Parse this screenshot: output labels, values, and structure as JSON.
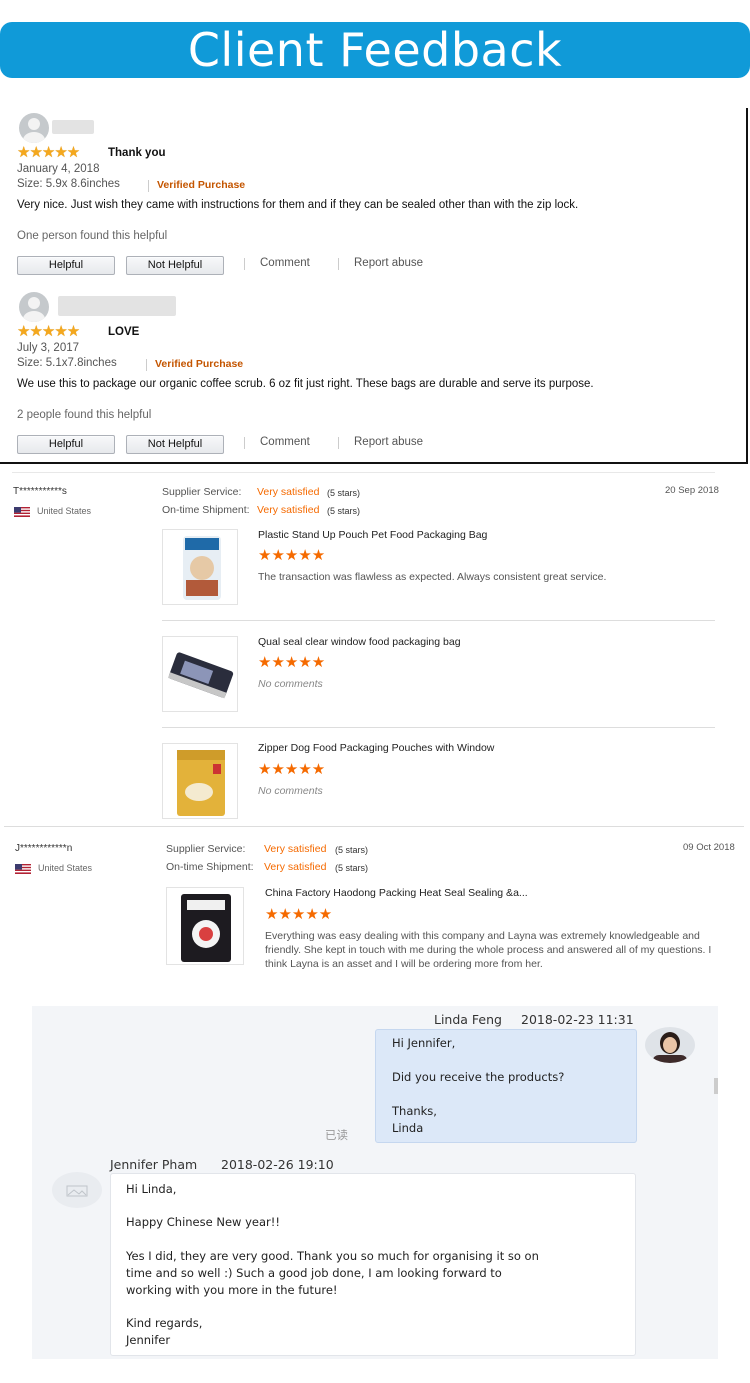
{
  "banner": {
    "title": "Client Feedback",
    "color": "#109ad8"
  },
  "amazon_reviews": [
    {
      "title": "Thank you",
      "date": "January 4, 2018",
      "size": "Size: 5.9x 8.6inches",
      "verified": "Verified Purchase",
      "text": "Very nice. Just wish they came with instructions for them and if they can be sealed other than with the zip lock.",
      "helpful_count": "One person found this helpful",
      "helpful_label": "Helpful",
      "not_helpful_label": "Not Helpful",
      "comment_label": "Comment",
      "report_label": "Report abuse",
      "stars": 5
    },
    {
      "title": "LOVE",
      "date": "July 3, 2017",
      "size": "Size: 5.1x7.8inches",
      "verified": "Verified Purchase",
      "text": "We use this to package our organic coffee scrub. 6 oz fit just right. These bags are durable and serve its purpose.",
      "helpful_count": "2 people found this helpful",
      "helpful_label": "Helpful",
      "not_helpful_label": "Not Helpful",
      "comment_label": "Comment",
      "report_label": "Report abuse",
      "stars": 5
    }
  ],
  "star_glyph": "★★★★★",
  "supplier_reviews": [
    {
      "buyer": "T***********s",
      "country": "United States",
      "date": "20 Sep 2018",
      "supplier_service_label": "Supplier Service:",
      "supplier_service_value": "Very satisfied",
      "supplier_service_stars": "(5 stars)",
      "shipment_label": "On-time Shipment:",
      "shipment_value": "Very satisfied",
      "shipment_stars": "(5 stars)",
      "products": [
        {
          "name": "Plastic Stand Up Pouch Pet Food Packaging Bag",
          "comment": "The transaction was flawless as expected. Always consistent great service.",
          "no_comment": false
        },
        {
          "name": "Qual seal clear window food packaging bag",
          "comment": "No comments",
          "no_comment": true
        },
        {
          "name": "Zipper Dog Food Packaging Pouches with Window",
          "comment": "No comments",
          "no_comment": true
        }
      ]
    },
    {
      "buyer": "J************n",
      "country": "United States",
      "date": "09 Oct 2018",
      "supplier_service_label": "Supplier Service:",
      "supplier_service_value": "Very satisfied",
      "supplier_service_stars": "(5 stars)",
      "shipment_label": "On-time Shipment:",
      "shipment_value": "Very satisfied",
      "shipment_stars": "(5 stars)",
      "products": [
        {
          "name": "China Factory Haodong Packing Heat Seal Sealing &a...",
          "comment_lines": [
            "Everything was easy dealing with this company and Layna was extremely knowledgeable and",
            "friendly. She kept in touch with me during the whole process and answered all of my questions. I",
            "think Layna is an asset and I will be ordering more from her."
          ]
        }
      ]
    }
  ],
  "chat": {
    "msg1": {
      "sender": "Linda Feng",
      "time": "2018-02-23 11:31",
      "lines": [
        "Hi Jennifer,",
        "Did you receive the products?",
        "Thanks,",
        "Linda"
      ],
      "read_label": "已读"
    },
    "msg2": {
      "sender": "Jennifer Pham",
      "time": "2018-02-26 19:10",
      "lines": [
        "Hi Linda,",
        "Happy Chinese New year!!",
        "Yes I did, they are very good. Thank you so much for organising it so on",
        "time and so well :) Such a good job done, I am looking forward to",
        "working with you more in the future!",
        "Kind regards,",
        "Jennifer"
      ]
    }
  },
  "colors": {
    "gold_star": "#f4a81e",
    "orange": "#f56a00",
    "verified": "#c45500",
    "chat_blue": "#dce8f8"
  }
}
